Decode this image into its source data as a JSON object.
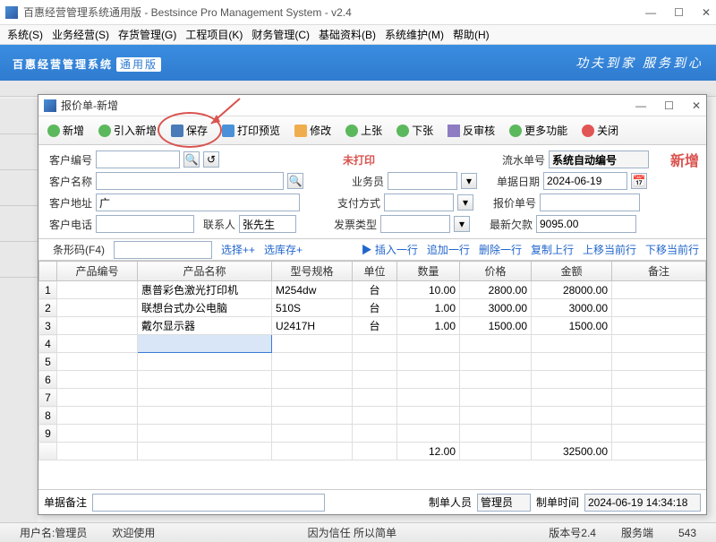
{
  "main_window": {
    "title": "百惠经营管理系统通用版 - Bestsince Pro Management System - v2.4",
    "controls": {
      "min": "—",
      "max": "☐",
      "close": "✕"
    }
  },
  "menubar": [
    "系统(S)",
    "业务经营(S)",
    "存货管理(G)",
    "工程项目(K)",
    "财务管理(C)",
    "基础资料(B)",
    "系统维护(M)",
    "帮助(H)"
  ],
  "banner": {
    "left": "百惠经营管理系统",
    "sub": "通用版",
    "right": "功夫到家 服务到心"
  },
  "dialog": {
    "title": "报价单-新增",
    "controls": {
      "min": "—",
      "max": "☐",
      "close": "✕"
    }
  },
  "toolbar": {
    "new": "新增",
    "copy_new": "引入新增",
    "save": "保存",
    "print_preview": "打印预览",
    "modify": "修改",
    "prev": "上张",
    "next": "下张",
    "unapprove": "反审核",
    "more": "更多功能",
    "close": "关闭"
  },
  "form": {
    "labels": {
      "cust_no": "客户编号",
      "cust_name": "客户名称",
      "cust_addr": "客户地址",
      "cust_tel": "客户电话",
      "contact": "联系人",
      "serial": "流水单号",
      "bill_date": "单据日期",
      "quote_no": "报价单号",
      "last_arrears": "最新欠款",
      "sales": "业务员",
      "pay_method": "支付方式",
      "invoice_type": "发票类型",
      "barcode": "条形码(F4)"
    },
    "values": {
      "cust_no": "",
      "cust_name": "",
      "cust_addr": "广",
      "cust_tel": "",
      "contact": "张先生",
      "serial": "系统自动编号",
      "bill_date": "2024-06-19",
      "quote_no": "",
      "last_arrears": "9095.00",
      "sales": "",
      "pay_method": "",
      "invoice_type": ""
    },
    "status_unprinted": "未打印",
    "badge_new": "新增",
    "select_pp": "选择++",
    "select_stock": "选库存+"
  },
  "table_actions": {
    "insert": "▶ 插入一行",
    "append": "追加一行",
    "delete": "删除一行",
    "copy_up": "复制上行",
    "move_up": "上移当前行",
    "move_down": "下移当前行"
  },
  "columns": [
    "产品编号",
    "产品名称",
    "型号规格",
    "单位",
    "数量",
    "价格",
    "金额",
    "备注"
  ],
  "rows": [
    {
      "code": "",
      "name": "惠普彩色激光打印机",
      "spec": "M254dw",
      "unit": "台",
      "qty": "10.00",
      "price": "2800.00",
      "amount": "28000.00",
      "remark": ""
    },
    {
      "code": "",
      "name": "联想台式办公电脑",
      "spec": "510S",
      "unit": "台",
      "qty": "1.00",
      "price": "3000.00",
      "amount": "3000.00",
      "remark": ""
    },
    {
      "code": "",
      "name": "戴尔显示器",
      "spec": "U2417H",
      "unit": "台",
      "qty": "1.00",
      "price": "1500.00",
      "amount": "1500.00",
      "remark": ""
    }
  ],
  "totals": {
    "qty": "12.00",
    "amount": "32500.00"
  },
  "footer": {
    "remark_label": "单据备注",
    "maker_label": "制单人员",
    "maker": "管理员",
    "maketime_label": "制单时间",
    "maketime": "2024-06-19 14:34:18"
  },
  "statusbar": {
    "user": "用户名:管理员",
    "welcome": "欢迎使用",
    "trust": "因为信任  所以简单",
    "version": "版本号2.4",
    "server": "服务端",
    "port": "543"
  }
}
